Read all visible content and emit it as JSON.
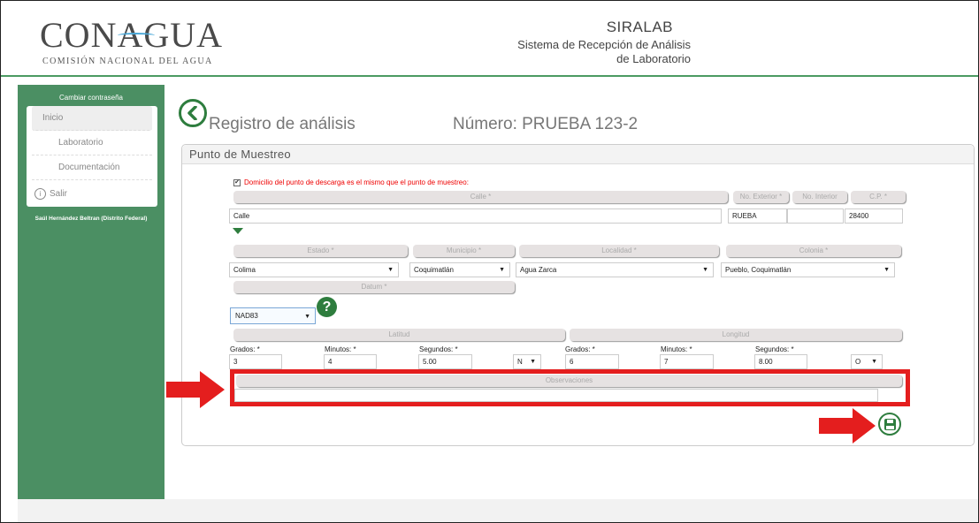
{
  "header": {
    "logo": "CONAGUA",
    "logo_subtitle": "COMISIÓN NACIONAL DEL AGUA",
    "app_name": "SIRALAB",
    "app_desc_line1": "Sistema de Recepción de Análisis",
    "app_desc_line2": "de Laboratorio"
  },
  "sidebar": {
    "change_password": "Cambiar contraseña",
    "items": [
      {
        "label": "Inicio"
      },
      {
        "label": "Laboratorio"
      },
      {
        "label": "Documentación"
      },
      {
        "label": "Salir"
      }
    ],
    "user": "Saúl Hernández Beltran (Distrito Federal)"
  },
  "page": {
    "title": "Registro de análisis",
    "number": "Número: PRUEBA 123-2"
  },
  "panel": {
    "heading": "Punto de Muestreo",
    "checkbox_label": "Domicilio del punto de descarga es el mismo que el punto de muestreo:",
    "checkbox_mark": "✔",
    "calle": {
      "label": "Calle *",
      "value": "Calle"
    },
    "no_exterior": {
      "label": "No. Exterior *",
      "value": "RUEBA"
    },
    "no_interior": {
      "label": "No. Interior",
      "value": ""
    },
    "cp": {
      "label": "C.P. *",
      "value": "28400"
    },
    "estado": {
      "label": "Estado *",
      "value": "Colima"
    },
    "municipio": {
      "label": "Municipio *",
      "value": "Coquimatlán"
    },
    "localidad": {
      "label": "Localidad *",
      "value": "Agua Zarca"
    },
    "colonia": {
      "label": "Colonia *",
      "value": "Pueblo, Coquimatlán"
    },
    "datum": {
      "label": "Datum *",
      "value": "NAD83"
    },
    "latitud": {
      "label": "Latitud",
      "grados_label": "Grados: *",
      "grados": "3",
      "minutos_label": "Minutos: *",
      "minutos": "4",
      "segundos_label": "Segundos: *",
      "segundos": "5.00",
      "hemisphere": "N"
    },
    "longitud": {
      "label": "Longitud",
      "grados_label": "Grados: *",
      "grados": "6",
      "minutos_label": "Minutos: *",
      "minutos": "7",
      "segundos_label": "Segundos: *",
      "segundos": "8.00",
      "hemisphere": "O"
    },
    "observaciones": {
      "label": "Observaciones",
      "value": ""
    }
  },
  "icons": {
    "back": "chevron-left-icon",
    "help": "?",
    "save": "floppy-disk-icon",
    "dropdown": "▼"
  },
  "colors": {
    "brand_green": "#4b8f63",
    "accent_green": "#2e7d3e",
    "highlight_red": "#e41e1e"
  }
}
